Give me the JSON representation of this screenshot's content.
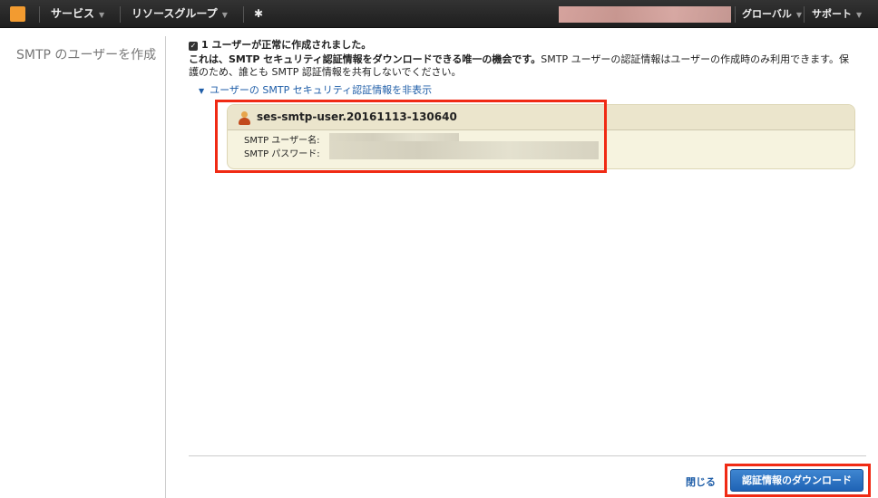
{
  "nav": {
    "services": "サービス",
    "resource_groups": "リソースグループ",
    "region": "グローバル",
    "support": "サポート"
  },
  "sidebar": {
    "title": "SMTP のユーザーを作成"
  },
  "main": {
    "success": "1 ユーザーが正常に作成されました。",
    "notice_bold": "これは、SMTP セキュリティ認証情報をダウンロードできる唯一の機会です。",
    "notice_rest": "SMTP ユーザーの認証情報はユーザーの作成時のみ利用できます。保",
    "notice_line2": "護のため、誰とも SMTP 認証情報を共有しないでください。",
    "toggle_link": "ユーザーの SMTP セキュリティ認証情報を非表示"
  },
  "credentials": {
    "user_name": "ses-smtp-user.20161113-130640",
    "smtp_user_label": "SMTP ユーザー名:",
    "smtp_password_label": "SMTP パスワード:"
  },
  "footer": {
    "close": "閉じる",
    "download": "認証情報のダウンロード"
  }
}
